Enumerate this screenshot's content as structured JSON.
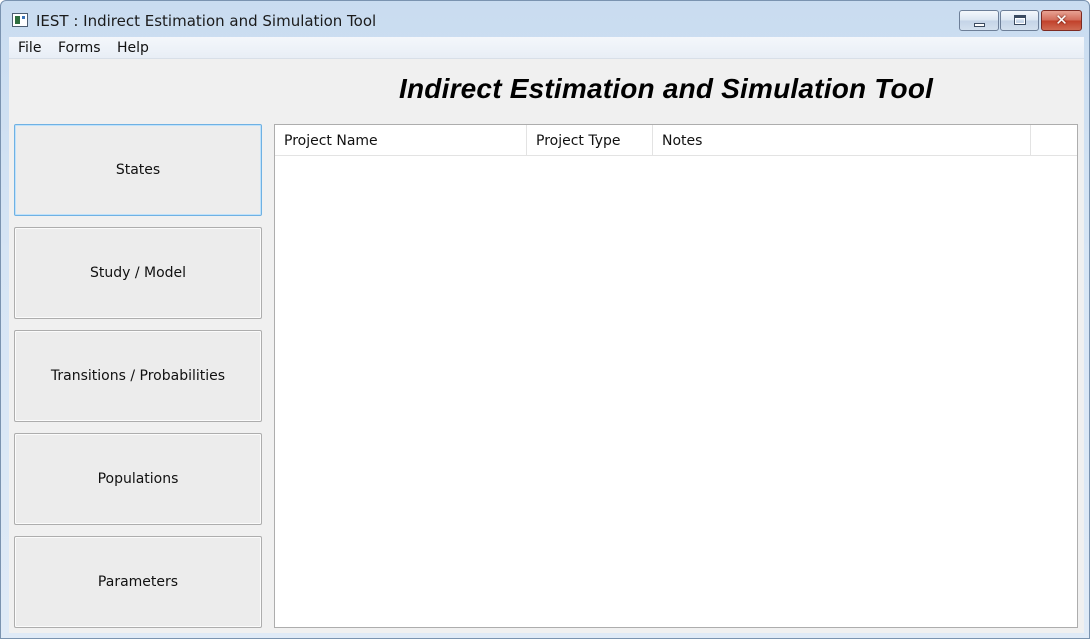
{
  "window": {
    "title": "IEST : Indirect Estimation and Simulation Tool",
    "close_symbol": "✕"
  },
  "menu": {
    "items": [
      "File",
      "Forms",
      "Help"
    ]
  },
  "heading": "Indirect Estimation and Simulation Tool",
  "nav": {
    "buttons": [
      {
        "label": "States",
        "active": true
      },
      {
        "label": "Study / Model",
        "active": false
      },
      {
        "label": "Transitions / Probabilities",
        "active": false
      },
      {
        "label": "Populations",
        "active": false
      },
      {
        "label": "Parameters",
        "active": false
      }
    ]
  },
  "projects_table": {
    "columns": [
      "Project Name",
      "Project Type",
      "Notes"
    ],
    "rows": []
  },
  "colors": {
    "active_border": "#6fb1e3",
    "close_button": "#c1402a"
  }
}
